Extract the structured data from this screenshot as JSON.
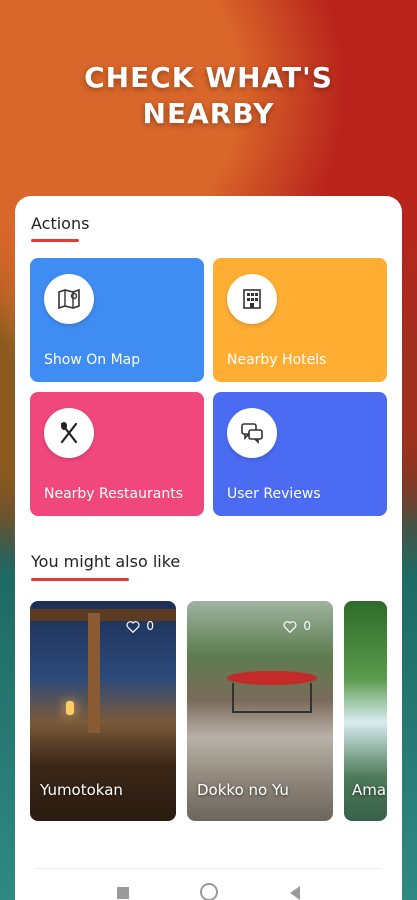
{
  "hero": {
    "line1": "CHECK WHAT'S",
    "line2": "NEARBY"
  },
  "actions_section": {
    "title": "Actions",
    "items": [
      {
        "label": "Show On Map",
        "icon": "map-icon",
        "color": "#3f8cf2"
      },
      {
        "label": "Nearby Hotels",
        "icon": "hotel-icon",
        "color": "#ffad33"
      },
      {
        "label": "Nearby Restaurants",
        "icon": "restaurant-icon",
        "color": "#f0487d"
      },
      {
        "label": "User Reviews",
        "icon": "reviews-icon",
        "color": "#4b6cf2"
      }
    ]
  },
  "recommend_section": {
    "title": "You might also like",
    "places": [
      {
        "name": "Yumotokan",
        "likes": "0"
      },
      {
        "name": "Dokko no Yu",
        "likes": "0"
      },
      {
        "name": "Ama"
      }
    ]
  },
  "colors": {
    "accent": "#e53935"
  }
}
